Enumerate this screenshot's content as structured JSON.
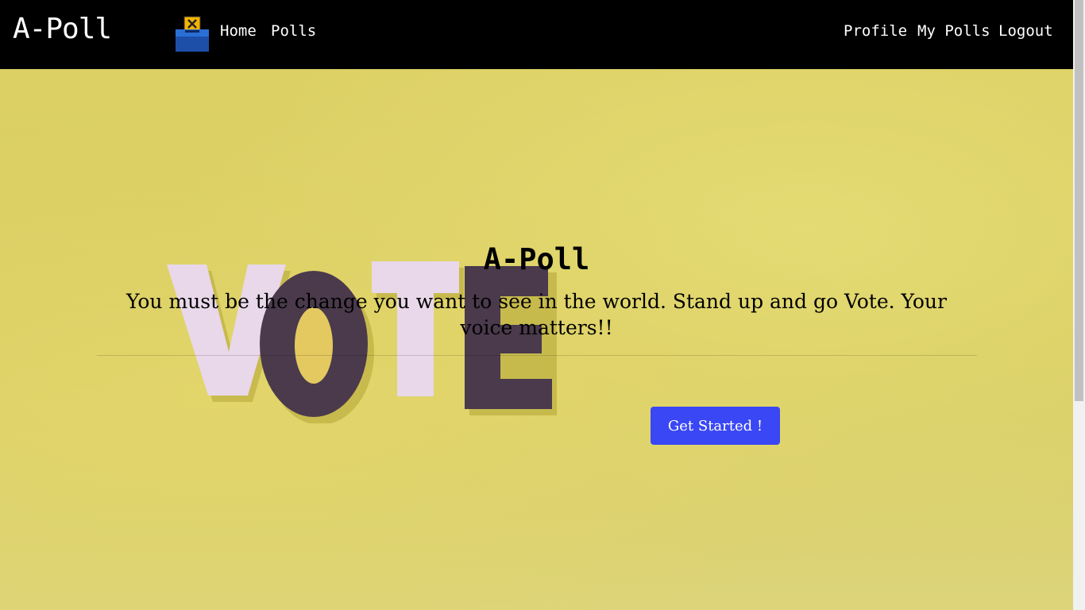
{
  "navbar": {
    "brand": "A-Poll",
    "left_links": [
      "Home",
      "Polls"
    ],
    "right_links": [
      "Profile",
      "My Polls",
      "Logout"
    ],
    "logo_icon": "ballot-box-icon"
  },
  "hero": {
    "title": "A-Poll",
    "tagline": "You must be the change you want to see in the world. Stand up and go Vote. Your voice matters!!",
    "cta_label": "Get Started !",
    "background_image_text": "VOTE"
  },
  "colors": {
    "navbar_bg": "#000000",
    "hero_bg": "#ddd46a",
    "cta_bg": "#3a47f5"
  }
}
